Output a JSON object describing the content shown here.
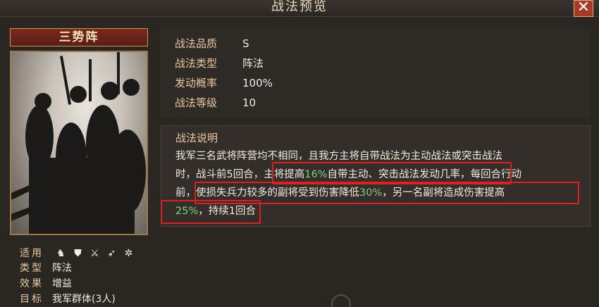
{
  "window": {
    "title": "战法预览",
    "close_icon": "close-icon"
  },
  "card": {
    "name": "三势阵"
  },
  "info": [
    {
      "label": "战法品质",
      "value": "S"
    },
    {
      "label": "战法类型",
      "value": "阵法"
    },
    {
      "label": "发动概率",
      "value": "100%"
    },
    {
      "label": "战法等级",
      "value": "10"
    }
  ],
  "description": {
    "heading": "战法说明",
    "line1": "我军三名武将阵营均不相同，且我方主将自带战法为主动战法或突击战法",
    "line2_a": "时，战斗前5回合，主将提高",
    "line2_b": "16%",
    "line2_c": "自带主动、突击战法发动几率，每回合行动",
    "line3_a": "前，使损失兵力较多的副将受到伤害降低",
    "line3_b": "30%",
    "line3_c": "，另一名副将造成伤害提高",
    "line4_a": "25%",
    "line4_b": "，持续1回合"
  },
  "attributes": {
    "applicable_label": "适用",
    "applicable_icons": [
      "cavalry-icon",
      "shield-icon",
      "crossed-swords-icon",
      "archer-icon",
      "siege-wheel-icon"
    ],
    "type_label": "类型",
    "type_value": "阵法",
    "effect_label": "效果",
    "effect_value": "增益",
    "target_label": "目标",
    "target_value": "我军群体(3人)"
  },
  "colors": {
    "highlight": "#7fd07a",
    "label": "#e8c9a0",
    "annotation_box": "#e02020"
  }
}
